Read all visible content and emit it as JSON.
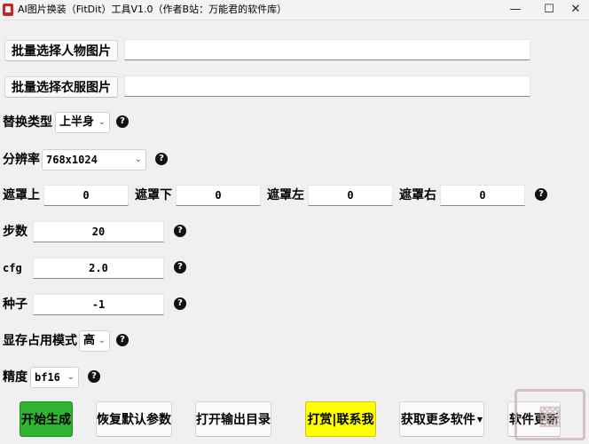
{
  "window": {
    "title": "AI图片换装（FitDit）工具V1.0（作者B站：万能君的软件库）",
    "minimize": "—",
    "maximize": "☐",
    "close": "✕"
  },
  "inputs": {
    "person_button": "批量选择人物图片",
    "person_path": "",
    "clothes_button": "批量选择衣服图片",
    "clothes_path": ""
  },
  "options": {
    "replace_type_label": "替换类型",
    "replace_type_value": "上半身",
    "resolution_label": "分辨率",
    "resolution_value": "768x1024",
    "mask_top_label": "遮罩上",
    "mask_top_value": "0",
    "mask_bottom_label": "遮罩下",
    "mask_bottom_value": "0",
    "mask_left_label": "遮罩左",
    "mask_left_value": "0",
    "mask_right_label": "遮罩右",
    "mask_right_value": "0",
    "steps_label": "步数",
    "steps_value": "20",
    "cfg_label": "cfg",
    "cfg_value": "2.0",
    "seed_label": "种子",
    "seed_value": "-1",
    "vram_label": "显存占用模式",
    "vram_value": "高",
    "precision_label": "精度",
    "precision_value": "bf16",
    "help_glyph": "?"
  },
  "actions": {
    "start": "开始生成",
    "reset": "恢复默认参数",
    "open_output": "打开输出目录",
    "donate": "打赏|联系我",
    "more_software": "获取更多软件",
    "update": "软件更新"
  },
  "icons": {
    "chevron": "chevron-down-icon",
    "help": "question-circle-icon"
  },
  "colors": {
    "start_bg": "#2fb52f",
    "donate_bg": "#ffff00",
    "background": "#f0f0f0"
  }
}
